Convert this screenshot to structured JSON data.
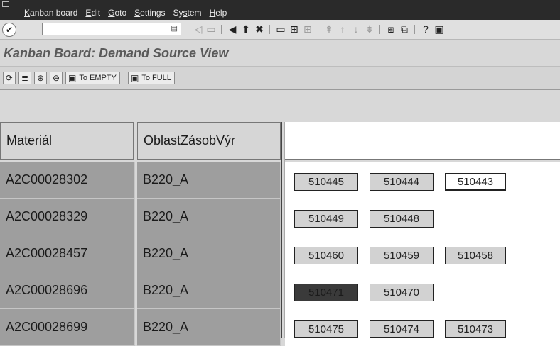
{
  "menubar": {
    "items": [
      {
        "pre": "",
        "key": "K",
        "rest": "anban board"
      },
      {
        "pre": "",
        "key": "E",
        "rest": "dit"
      },
      {
        "pre": "",
        "key": "G",
        "rest": "oto"
      },
      {
        "pre": "",
        "key": "S",
        "rest": "ettings"
      },
      {
        "pre": "Sy",
        "key": "s",
        "rest": "tem"
      },
      {
        "pre": "",
        "key": "H",
        "rest": "elp"
      }
    ]
  },
  "title": "Kanban Board: Demand Source View",
  "app_toolbar": {
    "to_empty": "To EMPTY",
    "to_full": "To FULL"
  },
  "columns": [
    "Materiál",
    "OblastZásobVýr"
  ],
  "rows": [
    {
      "material": "A2C00028302",
      "area": "B220_A",
      "containers": [
        {
          "id": "510445",
          "status": "in-process"
        },
        {
          "id": "510444",
          "status": "in-process"
        },
        {
          "id": "510443",
          "status": "empty"
        }
      ]
    },
    {
      "material": "A2C00028329",
      "area": "B220_A",
      "containers": [
        {
          "id": "510449",
          "status": "in-process"
        },
        {
          "id": "510448",
          "status": "in-process"
        }
      ]
    },
    {
      "material": "A2C00028457",
      "area": "B220_A",
      "containers": [
        {
          "id": "510460",
          "status": "in-process"
        },
        {
          "id": "510459",
          "status": "in-process"
        },
        {
          "id": "510458",
          "status": "in-process"
        }
      ]
    },
    {
      "material": "A2C00028696",
      "area": "B220_A",
      "containers": [
        {
          "id": "510471",
          "status": "full"
        },
        {
          "id": "510470",
          "status": "in-process"
        }
      ]
    },
    {
      "material": "A2C00028699",
      "area": "B220_A",
      "containers": [
        {
          "id": "510475",
          "status": "in-process"
        },
        {
          "id": "510474",
          "status": "in-process"
        },
        {
          "id": "510473",
          "status": "in-process"
        }
      ]
    }
  ],
  "colors": {
    "menubar_bg": "#2a2a2a",
    "row_bg": "#9e9e9e",
    "card_in_process": "#d2d2d2",
    "card_empty": "#ffffff",
    "card_full": "#3a3a3a"
  }
}
